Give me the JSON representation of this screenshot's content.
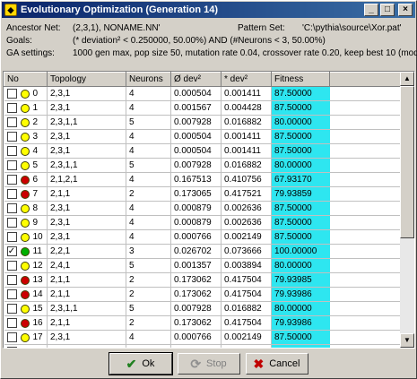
{
  "window": {
    "title": "Evolutionary Optimization (Generation 14)",
    "min_label": "_",
    "max_label": "□",
    "close_label": "×"
  },
  "info": {
    "ancestor_label": "Ancestor Net:",
    "ancestor_value": "(2,3,1), NONAME.NN'",
    "pattern_label": "Pattern Set:",
    "pattern_value": "'C:\\pythia\\source\\Xor.pat'",
    "goals_label": "Goals:",
    "goals_value": "(* deviation² <  0.250000, 50.00%)  AND   (#Neurons < 3, 50.00%)",
    "ga_label": "GA settings:",
    "ga_value": "1000 gen max, pop size 50, mutation rate 0.04, crossover rate 0.20, keep best 10 (modif)"
  },
  "table": {
    "headers": [
      "No",
      "Topology",
      "Neurons",
      "Ø dev²",
      "* dev²",
      "Fitness"
    ],
    "rows": [
      {
        "no": "0",
        "checked": false,
        "color": "#ffff00",
        "topology": "2,3,1",
        "neurons": "4",
        "avg": "0.000504",
        "max": "0.001411",
        "fitness": "87.50000"
      },
      {
        "no": "1",
        "checked": false,
        "color": "#ffff00",
        "topology": "2,3,1",
        "neurons": "4",
        "avg": "0.001567",
        "max": "0.004428",
        "fitness": "87.50000"
      },
      {
        "no": "2",
        "checked": false,
        "color": "#ffff00",
        "topology": "2,3,1,1",
        "neurons": "5",
        "avg": "0.007928",
        "max": "0.016882",
        "fitness": "80.00000"
      },
      {
        "no": "3",
        "checked": false,
        "color": "#ffff00",
        "topology": "2,3,1",
        "neurons": "4",
        "avg": "0.000504",
        "max": "0.001411",
        "fitness": "87.50000"
      },
      {
        "no": "4",
        "checked": false,
        "color": "#ffff00",
        "topology": "2,3,1",
        "neurons": "4",
        "avg": "0.000504",
        "max": "0.001411",
        "fitness": "87.50000"
      },
      {
        "no": "5",
        "checked": false,
        "color": "#ffff00",
        "topology": "2,3,1,1",
        "neurons": "5",
        "avg": "0.007928",
        "max": "0.016882",
        "fitness": "80.00000"
      },
      {
        "no": "6",
        "checked": false,
        "color": "#cc0000",
        "topology": "2,1,2,1",
        "neurons": "4",
        "avg": "0.167513",
        "max": "0.410756",
        "fitness": "67.93170"
      },
      {
        "no": "7",
        "checked": false,
        "color": "#cc0000",
        "topology": "2,1,1",
        "neurons": "2",
        "avg": "0.173065",
        "max": "0.417521",
        "fitness": "79.93859"
      },
      {
        "no": "8",
        "checked": false,
        "color": "#ffff00",
        "topology": "2,3,1",
        "neurons": "4",
        "avg": "0.000879",
        "max": "0.002636",
        "fitness": "87.50000"
      },
      {
        "no": "9",
        "checked": false,
        "color": "#ffff00",
        "topology": "2,3,1",
        "neurons": "4",
        "avg": "0.000879",
        "max": "0.002636",
        "fitness": "87.50000"
      },
      {
        "no": "10",
        "checked": false,
        "color": "#ffff00",
        "topology": "2,3,1",
        "neurons": "4",
        "avg": "0.000766",
        "max": "0.002149",
        "fitness": "87.50000"
      },
      {
        "no": "11",
        "checked": true,
        "color": "#00b000",
        "topology": "2,2,1",
        "neurons": "3",
        "avg": "0.026702",
        "max": "0.073666",
        "fitness": "100.00000"
      },
      {
        "no": "12",
        "checked": false,
        "color": "#ffff00",
        "topology": "2,4,1",
        "neurons": "5",
        "avg": "0.001357",
        "max": "0.003894",
        "fitness": "80.00000"
      },
      {
        "no": "13",
        "checked": false,
        "color": "#cc0000",
        "topology": "2,1,1",
        "neurons": "2",
        "avg": "0.173062",
        "max": "0.417504",
        "fitness": "79.93985"
      },
      {
        "no": "14",
        "checked": false,
        "color": "#cc0000",
        "topology": "2,1,1",
        "neurons": "2",
        "avg": "0.173062",
        "max": "0.417504",
        "fitness": "79.93986"
      },
      {
        "no": "15",
        "checked": false,
        "color": "#ffff00",
        "topology": "2,3,1,1",
        "neurons": "5",
        "avg": "0.007928",
        "max": "0.016882",
        "fitness": "80.00000"
      },
      {
        "no": "16",
        "checked": false,
        "color": "#cc0000",
        "topology": "2,1,1",
        "neurons": "2",
        "avg": "0.173062",
        "max": "0.417504",
        "fitness": "79.93986"
      },
      {
        "no": "17",
        "checked": false,
        "color": "#ffff00",
        "topology": "2,3,1",
        "neurons": "4",
        "avg": "0.000766",
        "max": "0.002149",
        "fitness": "87.50000"
      },
      {
        "no": "18",
        "checked": false,
        "color": "#ffff00",
        "topology": "2,3,1",
        "neurons": "4",
        "avg": "0.000766",
        "max": "0.002149",
        "fitness": "87.50000"
      }
    ]
  },
  "buttons": {
    "ok_label": "Ok",
    "ok_icon": "check-icon",
    "stop_label": "Stop",
    "stop_icon": "stop-icon",
    "cancel_label": "Cancel",
    "cancel_icon": "cancel-icon"
  },
  "colors": {
    "fitness_bg": "#2ee6f0",
    "title_bar": "#0a246a"
  }
}
